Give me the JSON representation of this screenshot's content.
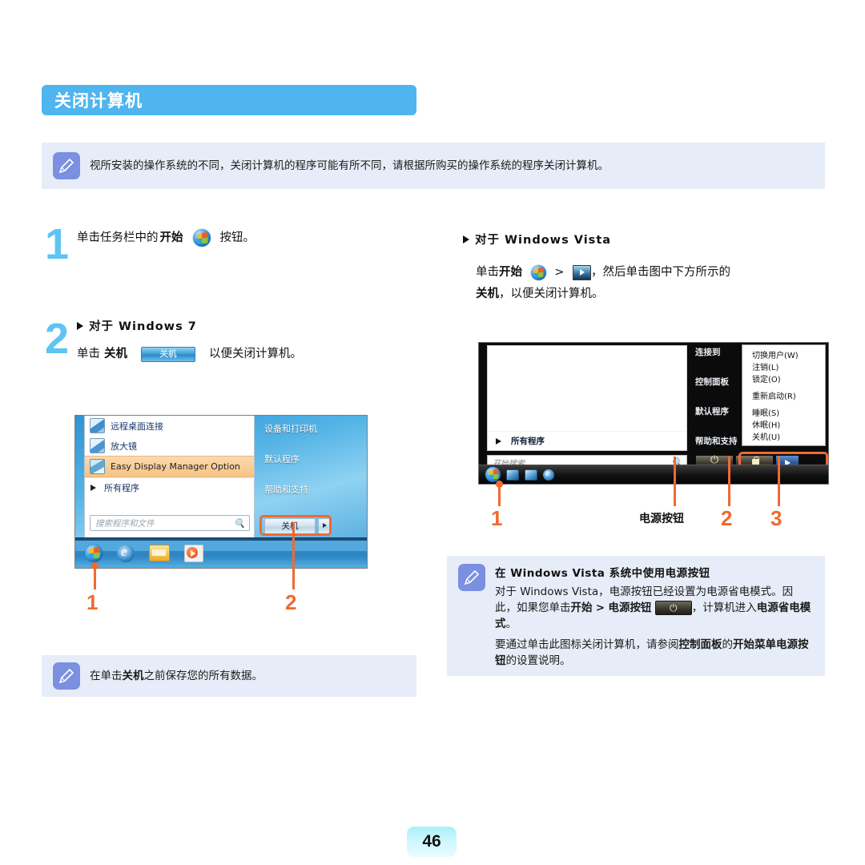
{
  "page": {
    "title": "关闭计算机",
    "page_number": "46",
    "accent_blue": "#4fb5ef",
    "note_bg": "#e7edf8",
    "callout_orange": "#ef6a32",
    "step_number_color": "#5ec4f2"
  },
  "top_note": {
    "text": "视所安装的操作系统的不同，关闭计算机的程序可能有所不同，请根据所购买的操作系统的程序关闭计算机。",
    "icon": "pencil-note-icon"
  },
  "steps": [
    {
      "number": "1",
      "text_before": "单击任务栏中的",
      "bold_1": "开始",
      "icon": "windows-start-orb-icon",
      "text_after": "按钮。"
    },
    {
      "number": "2",
      "heading": "对于 Windows 7",
      "line_before": "单击",
      "line_bold": "关机",
      "button_label": "关机",
      "line_after": "以便关闭计算机。"
    }
  ],
  "win7_figure": {
    "menu_items": [
      {
        "label": "远程桌面连接",
        "icon": "remote-desktop-icon",
        "highlighted": false
      },
      {
        "label": "放大镜",
        "icon": "magnifier-icon",
        "highlighted": false
      },
      {
        "label": "Easy Display Manager Option",
        "icon": "easy-display-manager-icon",
        "highlighted": true
      }
    ],
    "all_programs": "所有程序",
    "search_placeholder": "搜索程序和文件",
    "right_links": [
      "设备和打印机",
      "默认程序",
      "帮助和支持"
    ],
    "shutdown_button": "关机",
    "taskbar_icons": [
      "windows-start-orb-icon",
      "internet-explorer-icon",
      "file-explorer-icon",
      "media-player-icon"
    ],
    "callouts": [
      "1",
      "2"
    ]
  },
  "vista_block": {
    "heading": "对于 Windows Vista",
    "line1_a": "单击",
    "line1_bold": "开始",
    "line1_b": ">",
    "line1_c": "，然后单击图中下方所示的",
    "line2_bold": "关机",
    "line2_rest": "，以便关闭计算机。"
  },
  "vista_figure": {
    "all_programs": "所有程序",
    "search_placeholder": "开始搜索",
    "mid_links": [
      "连接到",
      "控制面板",
      "默认程序",
      "帮助和支持"
    ],
    "context_menu": [
      "切换用户(W)",
      "注销(L)",
      "锁定(O)",
      "重新启动(R)",
      "睡眠(S)",
      "休眠(H)",
      "关机(U)"
    ],
    "buttons": [
      "power-button-icon",
      "lock-button-icon",
      "arrow-button-icon"
    ],
    "taskbar_icons": [
      "windows-start-orb-icon",
      "show-desktop-icon",
      "switch-window-icon",
      "internet-explorer-icon"
    ],
    "callouts": [
      "1",
      "2",
      "3"
    ],
    "power_button_label": "电源按钮"
  },
  "left_bottom_note": {
    "text_a": "在单击",
    "text_bold": "关机",
    "text_b": "之前保存您的所有数据。"
  },
  "right_bottom_note": {
    "heading": "在 Windows Vista 系统中使用电源按钮",
    "p1_a": "对于 Windows Vista，电源按钮已经设置为电源省电模式。因此，如果您单击",
    "p1_bold1": "开始",
    "p1_mid": ">",
    "p1_bold2": "电源按钮",
    "p1_b": "，计算机进入",
    "p1_bold3": "电源省电模式",
    "p1_c": "。",
    "p2_a": "要通过单击此图标关闭计算机，请参阅",
    "p2_bold1": "控制面板",
    "p2_mid": "的",
    "p2_bold2": "开始菜单电源按钮",
    "p2_b": "的设置说明。"
  }
}
